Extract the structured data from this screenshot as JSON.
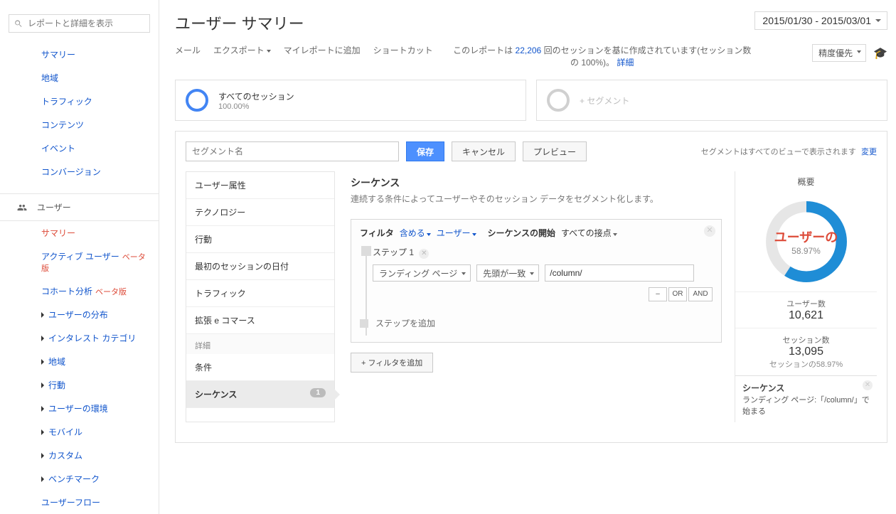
{
  "search_placeholder": "レポートと詳細を表示",
  "left_nav_simple": [
    "サマリー",
    "地域",
    "トラフィック",
    "コンテンツ",
    "イベント",
    "コンバージョン"
  ],
  "section_label": "ユーザー",
  "left_nav_user": [
    {
      "label": "サマリー",
      "active": true
    },
    {
      "label": "アクティブ ユーザー",
      "badge": "ベータ版"
    },
    {
      "label": "コホート分析",
      "badge": "ベータ版"
    },
    {
      "label": "ユーザーの分布",
      "caret": true
    },
    {
      "label": "インタレスト カテゴリ",
      "caret": true
    },
    {
      "label": "地域",
      "caret": true
    },
    {
      "label": "行動",
      "caret": true
    },
    {
      "label": "ユーザーの環境",
      "caret": true
    },
    {
      "label": "モバイル",
      "caret": true
    },
    {
      "label": "カスタム",
      "caret": true
    },
    {
      "label": "ベンチマーク",
      "caret": true
    },
    {
      "label": "ユーザーフロー"
    }
  ],
  "page_title": "ユーザー サマリー",
  "date_range": "2015/01/30 - 2015/03/01",
  "toolbar": {
    "mail": "メール",
    "export": "エクスポート",
    "myreport": "マイレポートに追加",
    "shortcut": "ショートカット",
    "note_prefix": "このレポートは",
    "sessions": "22,206",
    "note_mid": "回のセッションを基に作成されています(セッション数の 100%)。",
    "detail": "詳細",
    "precision": "精度優先"
  },
  "seg_all": {
    "title": "すべてのセッション",
    "pct": "100.00%"
  },
  "seg_add": "+ セグメント",
  "builder": {
    "name_ph": "セグメント名",
    "save": "保存",
    "cancel": "キャンセル",
    "preview": "プレビュー",
    "note": "セグメントはすべてのビューで表示されます",
    "change": "変更",
    "cats": [
      "ユーザー属性",
      "テクノロジー",
      "行動",
      "最初のセッションの日付",
      "トラフィック",
      "拡張 e コマース"
    ],
    "detail_hdr": "詳細",
    "detail_items": [
      {
        "label": "条件"
      },
      {
        "label": "シーケンス",
        "count": 1,
        "active": true
      }
    ],
    "center": {
      "h": "シーケンス",
      "desc": "連続する条件によってユーザーやそのセッション データをセグメント化します。",
      "filter": "フィルタ",
      "include": "含める",
      "user": "ユーザー",
      "seq_start": "シーケンスの開始",
      "any": "すべての接点",
      "step": "ステップ 1",
      "dim": "ランディング ページ",
      "match": "先頭が一致",
      "value": "/column/",
      "minus": "–",
      "or": "OR",
      "and": "AND",
      "add_step": "ステップを追加",
      "add_filter": "+ フィルタを追加"
    }
  },
  "summary": {
    "hdr": "概要",
    "donut_label": "ユーザーの",
    "pct": "58.97%",
    "m1": {
      "lbl": "ユーザー数",
      "val": "10,621"
    },
    "m2": {
      "lbl": "セッション数",
      "val": "13,095",
      "sub": "セッションの58.97%"
    },
    "seq_ttl": "シーケンス",
    "seq_desc": "ランディング ページ:「/column/」で始まる"
  }
}
